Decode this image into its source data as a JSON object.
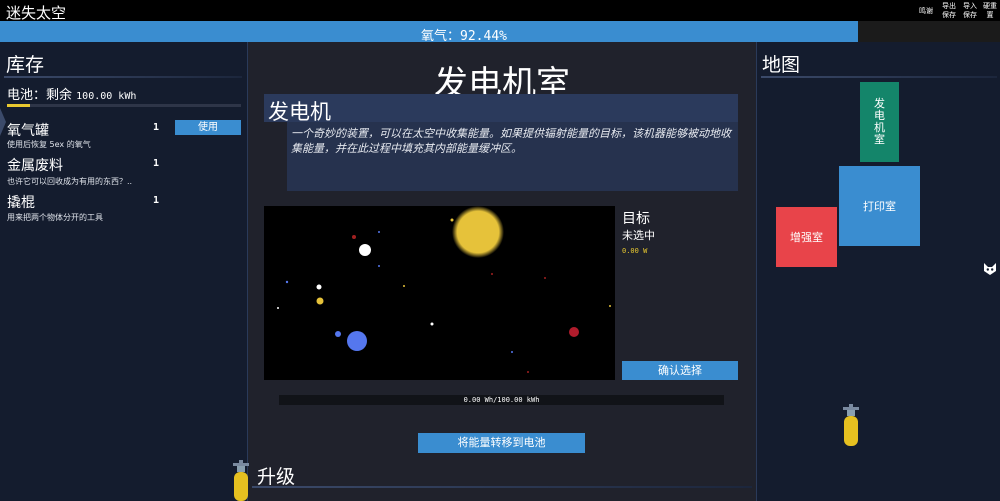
{
  "app": {
    "title": "迷失太空",
    "buttons": [
      {
        "id": "thanks",
        "label": "鸣谢"
      },
      {
        "id": "export",
        "label": "导出保存"
      },
      {
        "id": "import",
        "label": "导入保存"
      },
      {
        "id": "reset",
        "label": "硬重置"
      }
    ]
  },
  "oxygen": {
    "label": "氧气：92.44%",
    "level": 0.9244
  },
  "inventory": {
    "title": "库存",
    "battery": {
      "label": "电池：剩余",
      "value": "100.00 kWh",
      "level": 0.1
    },
    "items": [
      {
        "name": "氧气罐",
        "count": "1",
        "desc": "使用后恢复 5ex 的氧气",
        "action": "使用"
      },
      {
        "name": "金属废料",
        "count": "1",
        "desc": "也许它可以回收成为有用的东西？.."
      },
      {
        "name": "撬棍",
        "count": "1",
        "desc": "用来把两个物体分开的工具"
      }
    ]
  },
  "room": {
    "title": "发电机室",
    "generator": {
      "name": "发电机",
      "desc": "一个奇妙的装置，可以在太空中收集能量。如果提供辐射能量的目标，该机器能够被动地收集能量，并在此过程中填充其内部能量缓冲区。"
    },
    "target": {
      "label": "目标",
      "value": "未选中",
      "power": "0.00 W"
    },
    "confirm_label": "确认选择",
    "energy": {
      "text": "0.00 Wh/100.00 kWh",
      "level": 0
    },
    "transfer_label": "将能量转移到电池",
    "upgrade_title": "升级"
  },
  "map": {
    "title": "地图",
    "rooms": [
      {
        "id": "generator",
        "label": "发\n电\n机\n室",
        "color": "#14856a"
      },
      {
        "id": "printer",
        "label": "打印室",
        "color": "#3a8dd0"
      },
      {
        "id": "enhance",
        "label": "增强室",
        "color": "#e8444a"
      }
    ]
  },
  "icons": [
    "oxygen-tank-icon",
    "cat-icon",
    "collapse-arrow-icon"
  ]
}
